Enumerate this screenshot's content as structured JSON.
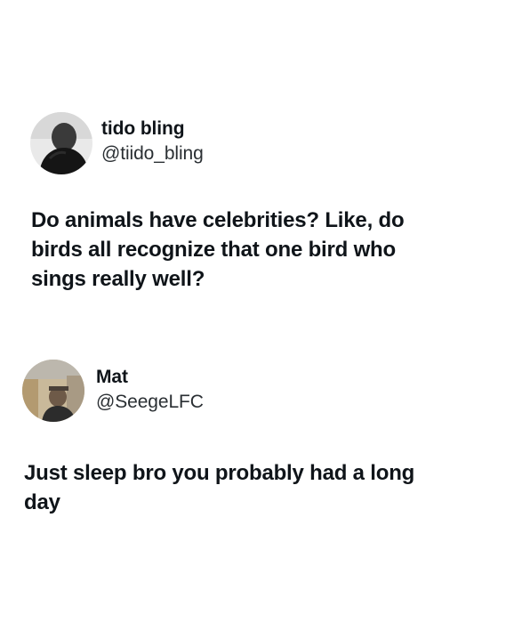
{
  "posts": [
    {
      "author": {
        "display_name": "tido bling",
        "handle": "@tiido_bling",
        "avatar_icon": "user-avatar"
      },
      "text": "Do animals have celebrities? Like, do\nbirds all recognize that one bird who\nsings really well?"
    },
    {
      "author": {
        "display_name": "Mat",
        "handle": "@SeegeLFC",
        "avatar_icon": "user-avatar"
      },
      "text": "Just sleep bro you probably had a long\nday"
    }
  ],
  "colors": {
    "background": "#ffffff",
    "text_primary": "#0f1419",
    "text_secondary": "#2a2f33"
  }
}
